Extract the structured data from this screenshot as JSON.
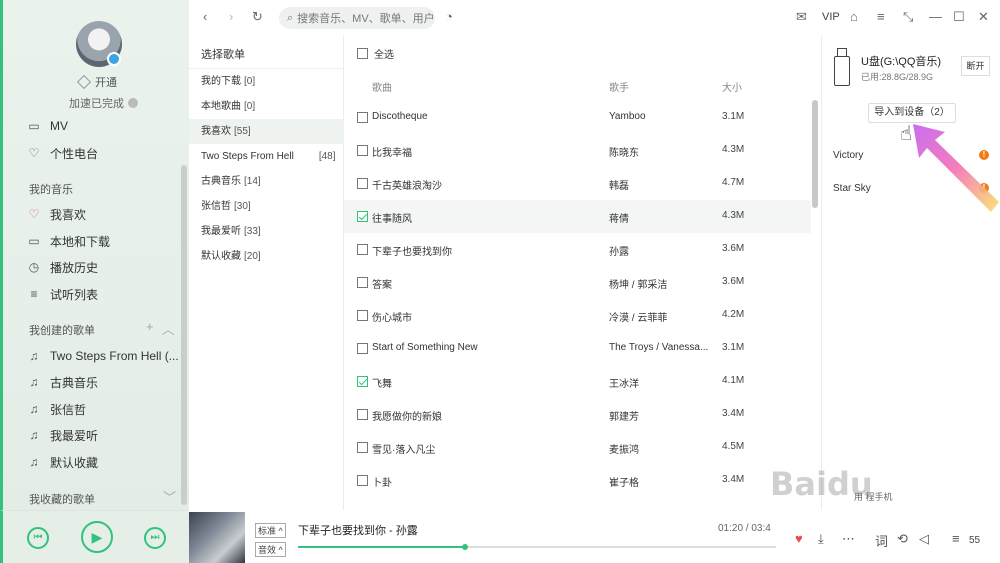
{
  "sidebar": {
    "vip_label": "开通",
    "accel_text": "加速已完成",
    "top_items": [
      {
        "label": "MV",
        "icon": "mv-icon"
      },
      {
        "label": "个性电台",
        "icon": "radio-icon"
      }
    ],
    "my_music_title": "我的音乐",
    "my_music": [
      {
        "label": "我喜欢",
        "icon": "heart-icon"
      },
      {
        "label": "本地和下载",
        "icon": "monitor-icon"
      },
      {
        "label": "播放历史",
        "icon": "clock-icon"
      },
      {
        "label": "试听列表",
        "icon": "list-icon"
      }
    ],
    "created_title": "我创建的歌单",
    "created": [
      {
        "label": "Two Steps From Hell (..."
      },
      {
        "label": "古典音乐"
      },
      {
        "label": "张信哲"
      },
      {
        "label": "我最爱听"
      },
      {
        "label": "默认收藏"
      }
    ],
    "collected_title": "我收藏的歌单"
  },
  "topbar": {
    "search_placeholder": "搜索音乐、MV、歌单、用户",
    "vip_label": "VIP"
  },
  "playlist_panel": {
    "title": "选择歌单",
    "items": [
      {
        "name": "我的下载",
        "count": "[0]"
      },
      {
        "name": "本地歌曲",
        "count": "[0]"
      },
      {
        "name": "我喜欢",
        "count": "[55]"
      },
      {
        "name": "Two Steps From Hell",
        "count": "[48]"
      },
      {
        "name": "古典音乐",
        "count": "[14]"
      },
      {
        "name": "张信哲",
        "count": "[30]"
      },
      {
        "name": "我最爱听",
        "count": "[33]"
      },
      {
        "name": "默认收藏",
        "count": "[20]"
      }
    ]
  },
  "song_table": {
    "select_all": "全选",
    "headers": {
      "title": "歌曲",
      "artist": "歌手",
      "size": "大小"
    },
    "rows": [
      {
        "title": "Discotheque",
        "artist": "Yamboo",
        "size": "3.1M",
        "checked": false
      },
      {
        "title": "比我幸福",
        "artist": "陈晓东",
        "size": "4.3M",
        "checked": false
      },
      {
        "title": "千古英雄浪淘沙",
        "artist": "韩磊",
        "size": "4.7M",
        "checked": false
      },
      {
        "title": "往事随风",
        "artist": "蒋倩",
        "size": "4.3M",
        "checked": true
      },
      {
        "title": "下辈子也要找到你",
        "artist": "孙露",
        "size": "3.6M",
        "checked": false
      },
      {
        "title": "答案",
        "artist": "杨坤 / 郭采洁",
        "size": "3.6M",
        "checked": false
      },
      {
        "title": "伤心城市",
        "artist": "冷漠 / 云菲菲",
        "size": "4.2M",
        "checked": false
      },
      {
        "title": "Start of Something New",
        "artist": "The Troys / Vanessa...",
        "size": "3.1M",
        "checked": false
      },
      {
        "title": "飞舞",
        "artist": "王冰洋",
        "size": "4.1M",
        "checked": true
      },
      {
        "title": "我愿做你的新娘",
        "artist": "郭建芳",
        "size": "3.4M",
        "checked": false
      },
      {
        "title": "雪见·落入凡尘",
        "artist": "麦振鸿",
        "size": "4.5M",
        "checked": false
      },
      {
        "title": "卜卦",
        "artist": "崔子格",
        "size": "3.4M",
        "checked": false
      }
    ]
  },
  "device": {
    "name": "U盘(G:\\QQ音乐)",
    "used": "已用:28.8G/28.9G",
    "disconnect_label": "断开",
    "import_label": "导入到设备（2）",
    "items": [
      "Victory",
      "Star Sky"
    ],
    "bottom_link": "用    程手机"
  },
  "player": {
    "quality_tag": "标准",
    "effect_tag": "音效",
    "now_playing": "下辈子也要找到你 - 孙露",
    "time": "01:20 / 03:4",
    "progress": 0.35,
    "playlist_count": "55"
  },
  "watermark": "Baidu",
  "colors": {
    "accent": "#31c27c",
    "warning": "#f07c16",
    "heart": "#e45050"
  }
}
